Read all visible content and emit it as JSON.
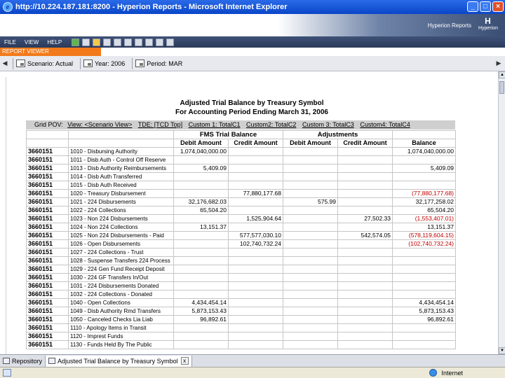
{
  "window": {
    "title": "http://10.224.187.181:8200 - Hyperion Reports - Microsoft Internet Explorer",
    "brand": "Hyperion Reports",
    "logo_word": "Hyperion",
    "logo_mark": "H"
  },
  "menubar": {
    "items": [
      "FILE",
      "VIEW",
      "HELP"
    ]
  },
  "viewer": {
    "label": "REPORT VIEWER"
  },
  "pov": {
    "scenario": "Scenario: Actual",
    "year": "Year: 2006",
    "period": "Period: MAR"
  },
  "report": {
    "title_line1": "Adjusted Trial Balance by Treasury Symbol",
    "title_line2": "For Accounting Period Ending March 31, 2006",
    "grid_pov": {
      "label": "Grid POV:",
      "items": [
        "View: <Scenario View>",
        "TDE: [TCD Top]",
        "Custom 1: TotalC1",
        "Custom2: TotalC2",
        "Custom 3: TotalC3",
        "Custom4: TotalC4"
      ]
    },
    "group_headers": {
      "fms": "FMS Trial Balance",
      "adjustments": "Adjustments"
    },
    "column_headers": {
      "debit": "Debit Amount",
      "credit": "Credit Amount",
      "adj_debit": "Debit Amount",
      "adj_credit": "Credit Amount",
      "balance": "Balance"
    },
    "rows": [
      {
        "sym": "3660151",
        "desc": "1010 - Disbursing Authority",
        "debit": "1,074,040,000.00",
        "credit": "",
        "adebit": "",
        "acredit": "",
        "balance": "1,074,040,000.00",
        "neg": false
      },
      {
        "sym": "3660151",
        "desc": "1011 - Disb Auth - Control Off Reserve",
        "debit": "",
        "credit": "",
        "adebit": "",
        "acredit": "",
        "balance": "",
        "neg": false
      },
      {
        "sym": "3660151",
        "desc": "1013 - Disb Authority Reimbursements",
        "debit": "5,409.09",
        "credit": "",
        "adebit": "",
        "acredit": "",
        "balance": "5,409.09",
        "neg": false
      },
      {
        "sym": "3660151",
        "desc": "1014 - Disb Auth Transferred",
        "debit": "",
        "credit": "",
        "adebit": "",
        "acredit": "",
        "balance": "",
        "neg": false
      },
      {
        "sym": "3660151",
        "desc": "1015 - Disb Auth Received",
        "debit": "",
        "credit": "",
        "adebit": "",
        "acredit": "",
        "balance": "",
        "neg": false
      },
      {
        "sym": "3660151",
        "desc": "1020 - Treasury Disbursement",
        "debit": "",
        "credit": "77,880,177.68",
        "adebit": "",
        "acredit": "",
        "balance": "(77,880,177.68)",
        "neg": true
      },
      {
        "sym": "3660151",
        "desc": "1021 - 224 Disbursements",
        "debit": "32,176,682.03",
        "credit": "",
        "adebit": "575.99",
        "acredit": "",
        "balance": "32,177,258.02",
        "neg": false
      },
      {
        "sym": "3660151",
        "desc": "1022 - 224 Collections",
        "debit": "65,504.20",
        "credit": "",
        "adebit": "",
        "acredit": "",
        "balance": "65,504.20",
        "neg": false
      },
      {
        "sym": "3660151",
        "desc": "1023 - Non 224 Disbursements",
        "debit": "",
        "credit": "1,525,904.64",
        "adebit": "",
        "acredit": "27,502.33",
        "balance": "(1,553,407.01)",
        "neg": true
      },
      {
        "sym": "3660151",
        "desc": "1024 - Non 224 Collections",
        "debit": "13,151.37",
        "credit": "",
        "adebit": "",
        "acredit": "",
        "balance": "13,151.37",
        "neg": false
      },
      {
        "sym": "3660151",
        "desc": "1025 - Non 224 Disbursements - Paid",
        "debit": "",
        "credit": "577,577,030.10",
        "adebit": "",
        "acredit": "542,574.05",
        "balance": "(578,119,604.15)",
        "neg": true
      },
      {
        "sym": "3660151",
        "desc": "1026 - Open Disbursements",
        "debit": "",
        "credit": "102,740,732.24",
        "adebit": "",
        "acredit": "",
        "balance": "(102,740,732.24)",
        "neg": true
      },
      {
        "sym": "3660151",
        "desc": "1027 - 224 Collections - Trust",
        "debit": "",
        "credit": "",
        "adebit": "",
        "acredit": "",
        "balance": "",
        "neg": false
      },
      {
        "sym": "3660151",
        "desc": "1028 - Suspense Transfers 224 Process",
        "debit": "",
        "credit": "",
        "adebit": "",
        "acredit": "",
        "balance": "",
        "neg": false
      },
      {
        "sym": "3660151",
        "desc": "1029 - 224 Gen Fund Receipt Deposit",
        "debit": "",
        "credit": "",
        "adebit": "",
        "acredit": "",
        "balance": "",
        "neg": false
      },
      {
        "sym": "3660151",
        "desc": "1030 - 224 GF Transfers In/Out",
        "debit": "",
        "credit": "",
        "adebit": "",
        "acredit": "",
        "balance": "",
        "neg": false
      },
      {
        "sym": "3660151",
        "desc": "1031 - 224 Disbursements Donated",
        "debit": "",
        "credit": "",
        "adebit": "",
        "acredit": "",
        "balance": "",
        "neg": false
      },
      {
        "sym": "3660151",
        "desc": "1032 - 224 Collections - Donated",
        "debit": "",
        "credit": "",
        "adebit": "",
        "acredit": "",
        "balance": "",
        "neg": false
      },
      {
        "sym": "3660151",
        "desc": "1040 - Open Collections",
        "debit": "4,434,454.14",
        "credit": "",
        "adebit": "",
        "acredit": "",
        "balance": "4,434,454.14",
        "neg": false
      },
      {
        "sym": "3660151",
        "desc": "1049 - Disb Authority Rmd Transfers",
        "debit": "5,873,153.43",
        "credit": "",
        "adebit": "",
        "acredit": "",
        "balance": "5,873,153.43",
        "neg": false
      },
      {
        "sym": "3660151",
        "desc": "1050 - Canceled Checks Lia Liab",
        "debit": "96,892.61",
        "credit": "",
        "adebit": "",
        "acredit": "",
        "balance": "96,892.61",
        "neg": false
      },
      {
        "sym": "3660151",
        "desc": "1110 - Apology Items in Transit",
        "debit": "",
        "credit": "",
        "adebit": "",
        "acredit": "",
        "balance": "",
        "neg": false
      },
      {
        "sym": "3660151",
        "desc": "1120 - Imprest Funds",
        "debit": "",
        "credit": "",
        "adebit": "",
        "acredit": "",
        "balance": "",
        "neg": false
      },
      {
        "sym": "3660151",
        "desc": "1130 - Funds Held By The Public",
        "debit": "",
        "credit": "",
        "adebit": "",
        "acredit": "",
        "balance": "",
        "neg": false
      }
    ]
  },
  "tabs": {
    "repository": "Repository",
    "report": "Adjusted Trial Balance by Treasury Symbol",
    "close": "x"
  },
  "status": {
    "zone": "Internet"
  },
  "colors": {
    "accent_orange": "#f27a1a",
    "title_blue": "#0a46c8",
    "negative_red": "#c00000"
  }
}
